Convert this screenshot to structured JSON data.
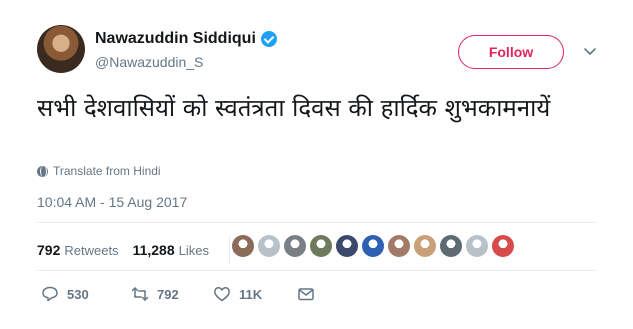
{
  "author": {
    "name": "Nawazuddin Siddiqui",
    "handle": "@Nawazuddin_S",
    "verified_icon": "verified-badge-icon"
  },
  "follow_label": "Follow",
  "tweet": {
    "text": "सभी देशवासियों को स्वतंत्रता दिवस की हार्दिक शुभकामनायें",
    "translate_label": "Translate from Hindi",
    "timestamp": "10:04 AM - 15 Aug 2017"
  },
  "stats": {
    "retweets_count": "792",
    "retweets_label": "Retweets",
    "likes_count": "11,288",
    "likes_label": "Likes"
  },
  "likers": [
    {
      "color": "#8b6b5a"
    },
    {
      "color": "#b8c0c8"
    },
    {
      "color": "#7a7f86"
    },
    {
      "color": "#6f7a5c"
    },
    {
      "color": "#3b4a6b"
    },
    {
      "color": "#2d5fb3"
    },
    {
      "color": "#a37a68"
    },
    {
      "color": "#c9a07a"
    },
    {
      "color": "#5d6a72"
    },
    {
      "color": "#b8c0c8"
    },
    {
      "color": "#d94b4b"
    }
  ],
  "actions": {
    "reply_count": "530",
    "retweet_count": "792",
    "like_count": "11K"
  },
  "colors": {
    "accent": "#e0245e",
    "verified": "#1da1f2",
    "muted": "#657786"
  }
}
